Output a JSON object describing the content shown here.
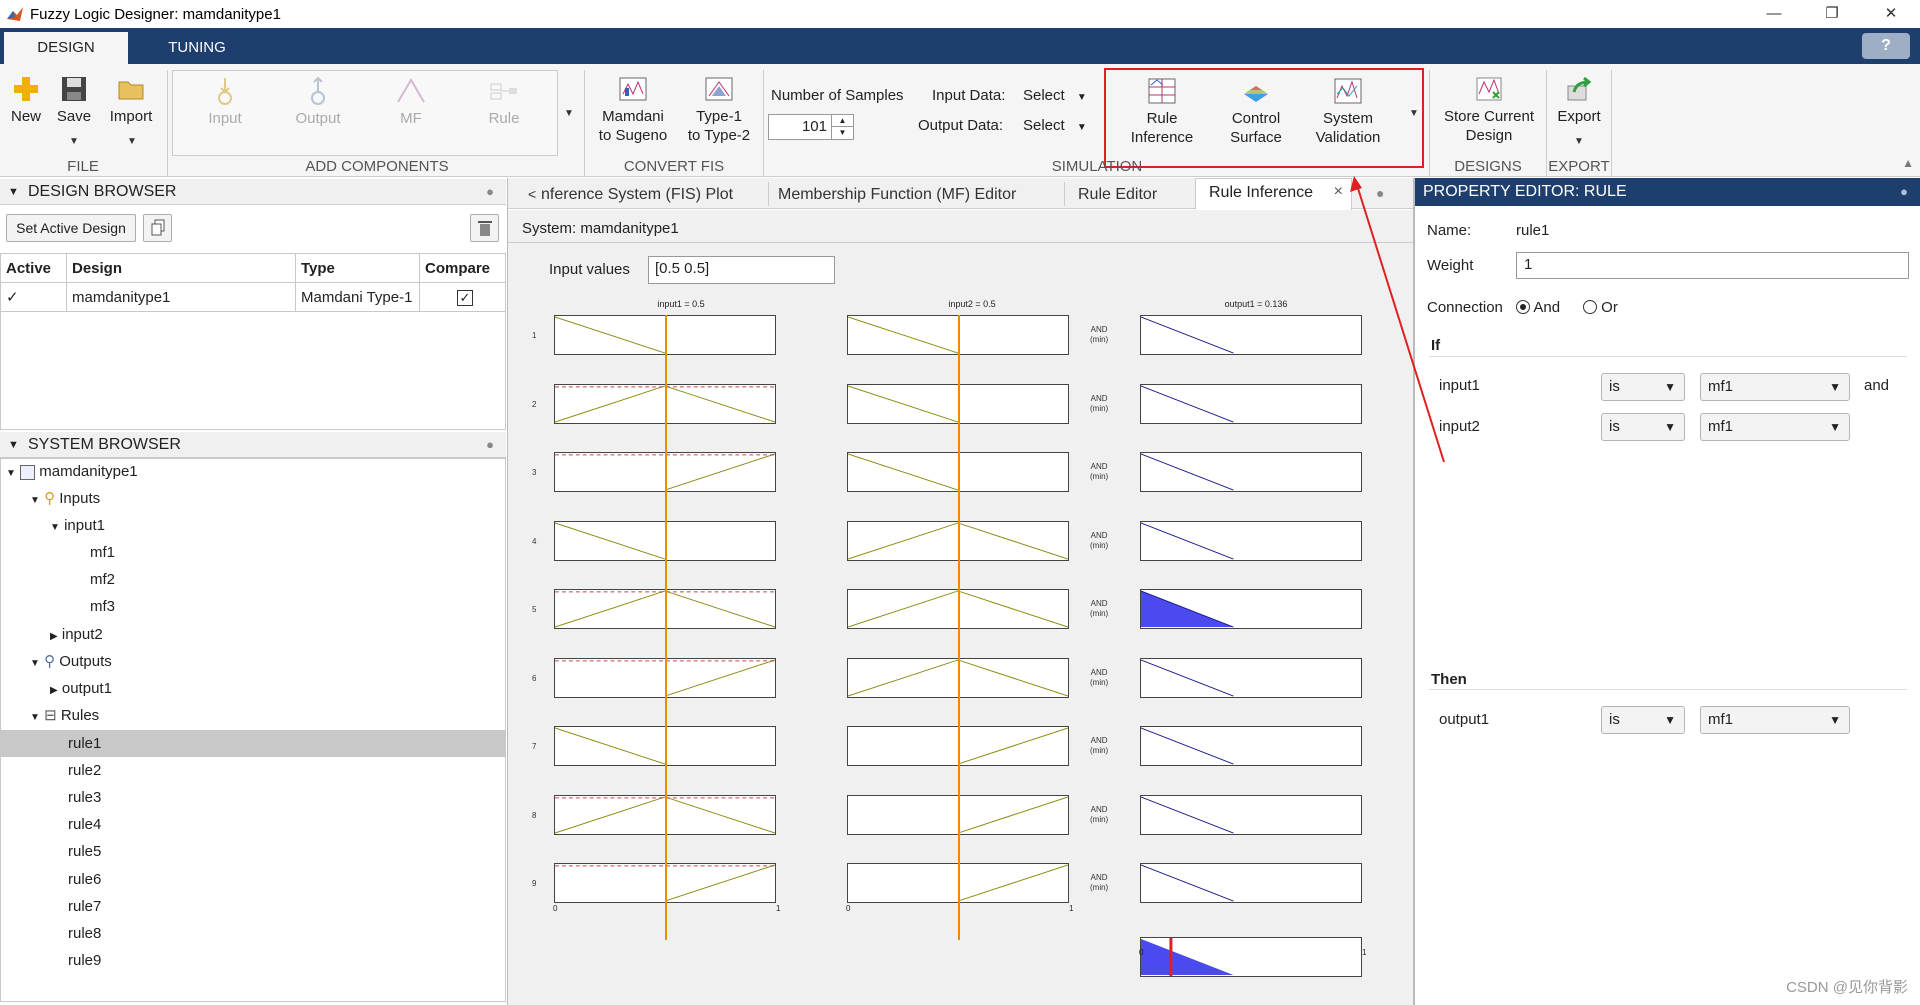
{
  "window": {
    "title": "Fuzzy Logic Designer: mamdanitype1",
    "minimize": "—",
    "restore": "❐",
    "close": "✕"
  },
  "tabs": {
    "design": "DESIGN",
    "tuning": "TUNING",
    "help": "?"
  },
  "ribbon": {
    "file": {
      "new": "New",
      "save": "Save",
      "import": "Import",
      "group": "FILE"
    },
    "add_components": {
      "input": "Input",
      "output": "Output",
      "mf": "MF",
      "rule": "Rule",
      "group": "ADD COMPONENTS"
    },
    "convert": {
      "mamdani_l1": "Mamdani",
      "mamdani_l2": "to Sugeno",
      "type1_l1": "Type-1",
      "type1_l2": "to Type-2",
      "group": "CONVERT FIS"
    },
    "samples": {
      "label": "Number of Samples",
      "value": "101",
      "input_data": "Input Data:",
      "output_data": "Output Data:",
      "select1": "Select",
      "select2": "Select"
    },
    "simulation": {
      "rule_l1": "Rule",
      "rule_l2": "Inference",
      "control_l1": "Control",
      "control_l2": "Surface",
      "sysval_l1": "System",
      "sysval_l2": "Validation",
      "group": "SIMULATION"
    },
    "designs": {
      "store_l1": "Store Current",
      "store_l2": "Design",
      "group": "DESIGNS"
    },
    "export": {
      "export": "Export",
      "group": "EXPORT"
    }
  },
  "design_browser": {
    "header": "DESIGN BROWSER",
    "set_active": "Set Active Design",
    "columns": [
      "Active",
      "Design",
      "Type",
      "Compare"
    ],
    "rows": [
      {
        "active": "✓",
        "design": "mamdanitype1",
        "type": "Mamdani Type-1",
        "compare": "✓"
      }
    ]
  },
  "system_browser": {
    "header": "SYSTEM BROWSER",
    "root": "mamdanitype1",
    "inputs": "Inputs",
    "input1": "input1",
    "mf1": "mf1",
    "mf2": "mf2",
    "mf3": "mf3",
    "input2": "input2",
    "outputs": "Outputs",
    "output1": "output1",
    "rules": "Rules",
    "rule_items": [
      "rule1",
      "rule2",
      "rule3",
      "rule4",
      "rule5",
      "rule6",
      "rule7",
      "rule8",
      "rule9"
    ]
  },
  "doc_tabs": {
    "fis": "nference System (FIS) Plot",
    "mf": "Membership Function (MF) Editor",
    "rule_editor": "Rule Editor",
    "rule_inference": "Rule Inference",
    "close": "×"
  },
  "inference": {
    "system": "System: mamdanitype1",
    "input_values_label": "Input values",
    "input_values": "[0.5 0.5]",
    "col1": "input1 = 0.5",
    "col2": "input2 = 0.5",
    "col3": "output1 = 0.136",
    "and_top": "AND",
    "and_bot": "(min)",
    "axis_min": "0",
    "axis_max": "1",
    "rule_numbers": [
      "1",
      "2",
      "3",
      "4",
      "5",
      "6",
      "7",
      "8",
      "9"
    ],
    "input1_value": 0.5,
    "input2_value": 0.5,
    "output_value": 0.136
  },
  "property_editor": {
    "header": "PROPERTY EDITOR: RULE",
    "name_label": "Name:",
    "name_value": "rule1",
    "weight_label": "Weight",
    "weight_value": "1",
    "connection_label": "Connection",
    "and": "And",
    "or": "Or",
    "if": "If",
    "then": "Then",
    "is": "is",
    "and_word": "and",
    "input1": "input1",
    "input2": "input2",
    "output1": "output1",
    "mf1": "mf1"
  },
  "watermark": "CSDN @见你背影",
  "colors": {
    "accent": "#1e3f6e",
    "highlight_box": "#e02020",
    "orange_line": "#f08a00",
    "olive_mf": "#8a8a10",
    "blue_mf": "#1a1a8a",
    "fill": "#4a4aee"
  }
}
